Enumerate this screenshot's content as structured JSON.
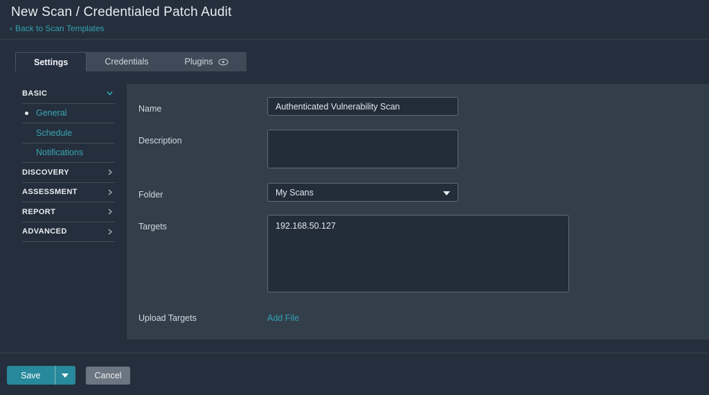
{
  "header": {
    "title": "New Scan / Credentialed Patch Audit",
    "back_arrow": "‹",
    "back_link": "Back to Scan Templates"
  },
  "tabs": [
    {
      "label": "Settings",
      "active": true
    },
    {
      "label": "Credentials",
      "active": false
    },
    {
      "label": "Plugins",
      "active": false,
      "icon": "eye-icon"
    }
  ],
  "sidebar": {
    "sections": [
      {
        "label": "BASIC",
        "state": "expanded",
        "items": [
          {
            "label": "General",
            "active": true
          },
          {
            "label": "Schedule",
            "active": false
          },
          {
            "label": "Notifications",
            "active": false
          }
        ]
      },
      {
        "label": "DISCOVERY",
        "state": "collapsed"
      },
      {
        "label": "ASSESSMENT",
        "state": "collapsed"
      },
      {
        "label": "REPORT",
        "state": "collapsed"
      },
      {
        "label": "ADVANCED",
        "state": "collapsed"
      }
    ]
  },
  "form": {
    "name": {
      "label": "Name",
      "value": "Authenticated Vulnerability Scan"
    },
    "description": {
      "label": "Description",
      "value": ""
    },
    "folder": {
      "label": "Folder",
      "value": "My Scans",
      "icon": "caret-down-icon"
    },
    "targets": {
      "label": "Targets",
      "value": "192.168.50.127"
    },
    "upload_targets": {
      "label": "Upload Targets",
      "link_label": "Add File"
    }
  },
  "footer": {
    "save_label": "Save",
    "cancel_label": "Cancel"
  },
  "colors": {
    "page_background": "#252e3c",
    "panel_background": "#333e4b",
    "accent_teal": "#31a3b0",
    "save_button": "#27899b",
    "cancel_button": "#6c7582",
    "input_background": "#232d3a"
  }
}
